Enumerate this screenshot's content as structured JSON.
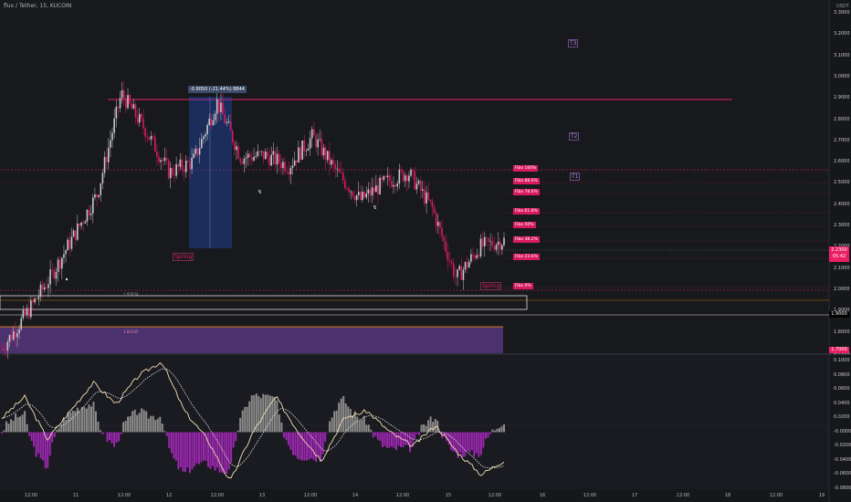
{
  "header": {
    "symbol_text": "flux / Tether, 15, KUCOIN"
  },
  "price_axis": {
    "currency": "USDT",
    "labels": [
      "3.3000",
      "3.2000",
      "3.1000",
      "3.0000",
      "2.9000",
      "2.8000",
      "2.7000",
      "2.6000",
      "2.5000",
      "2.4000",
      "2.3000",
      "2.2000",
      "2.1000",
      "2.0000",
      "1.9000",
      "1.8000",
      "1.7000"
    ],
    "current_price": "2.2300",
    "current_countdown": "05:42",
    "marker_price": "1.9000",
    "bottom_price": "1.7000"
  },
  "indicator_axis": {
    "labels": [
      "0.1000",
      "0.0800",
      "0.0600",
      "0.0400",
      "0.0200",
      "-0.0000",
      "-0.0200",
      "-0.0400",
      "-0.0600",
      "-0.0800"
    ]
  },
  "time_axis": {
    "labels": [
      "12:00",
      "11",
      "12:00",
      "12",
      "12:00",
      "13",
      "12:00",
      "14",
      "12:00",
      "15",
      "12:00",
      "16",
      "12:00",
      "17",
      "12:00",
      "18",
      "12:00",
      "19"
    ]
  },
  "annotations": {
    "range_label": "-0.8050 (-21.44%) 8844",
    "spring_left": "Spring",
    "spring_right": "Spring",
    "t1": "T1",
    "t2": "T2",
    "t3": "T3",
    "fib_levels": [
      "Fibo 100%",
      "Fibo 88.6%",
      "Fibo 78.6%",
      "Fibo 61.8%",
      "Fibo 50%",
      "Fibo 38.2%",
      "Fibo 23.6%",
      "Fibo 0%"
    ],
    "zone_label_1": "1.97654",
    "zone_label_2": "1.84345"
  },
  "colors": {
    "background": "#16171b",
    "resistance": "#e91e63",
    "fib": "#d81b60",
    "zone_purple": "#5c3a8a",
    "range_box": "#2962ff",
    "macd_fast": "#f5deb3",
    "macd_slow": "#e8e8e8",
    "hist_pos": "#8c8c8c",
    "hist_neg": "#9c27b0"
  },
  "chart_data": {
    "type": "candlestick",
    "title": "flux / Tether, 15, KUCOIN",
    "ylim": [
      1.7,
      3.3
    ],
    "x": [
      "12:00",
      "11",
      "12:00",
      "12",
      "12:00",
      "13",
      "12:00",
      "14",
      "12:00",
      "15",
      "12:00"
    ],
    "approx_close_path": [
      1.72,
      1.88,
      2.05,
      2.25,
      2.45,
      2.92,
      2.75,
      2.55,
      2.6,
      2.88,
      2.62,
      2.63,
      2.58,
      2.72,
      2.55,
      2.42,
      2.5,
      2.55,
      2.38,
      2.05,
      2.2,
      2.23
    ],
    "resistance_level": 2.9,
    "support_level": 1.9,
    "indicator": {
      "name": "MACD",
      "ylim": [
        -0.08,
        0.1
      ],
      "macd_approx": [
        0.02,
        0.05,
        -0.01,
        0.03,
        0.07,
        0.04,
        0.08,
        0.1,
        0.03,
        -0.01,
        -0.07,
        0.0,
        0.05,
        0.0,
        -0.04,
        0.02,
        0.03,
        0.0,
        -0.02,
        0.01,
        -0.03,
        -0.06,
        -0.04
      ]
    }
  }
}
